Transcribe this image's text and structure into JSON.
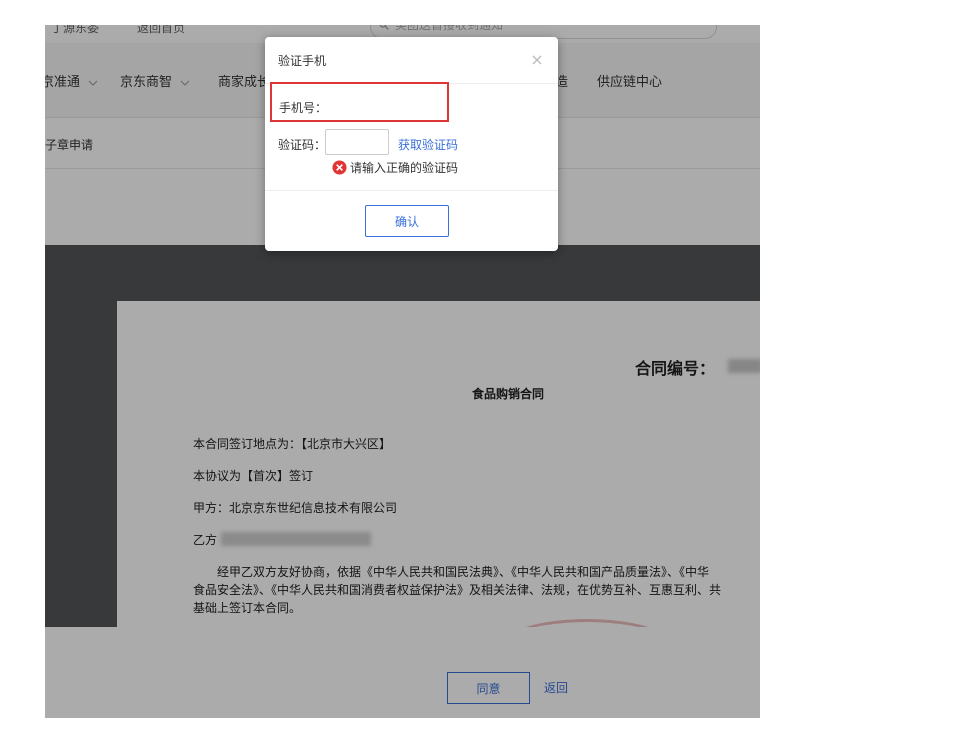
{
  "topbar": {
    "items": [
      "丁源东委",
      "返回首页"
    ],
    "search_placeholder": "美团送首接收到通知"
  },
  "nav": {
    "items": [
      "京准通",
      "京东商智",
      "商家成长",
      "造",
      "供应链中心"
    ]
  },
  "subnav": {
    "item": "子章申请"
  },
  "document": {
    "contract_no_label": "合同编号：",
    "title": "食品购销合同",
    "lines": [
      "本合同签订地点为：【北京市大兴区】",
      "本协议为【首次】签订",
      "甲方：北京京东世纪信息技术有限公司",
      "乙方",
      "　　经甲乙双方友好协商，依据《中华人民共和国民法典》、《中华人民共和国产品质量法》、《中华",
      "食品安全法》、《中华人民共和国消费者权益保护法》及相关法律、法规，在优势互补、互惠互利、共",
      "基础上签订本合同。"
    ]
  },
  "footer": {
    "agree_label": "同意",
    "back_label": "返回"
  },
  "modal": {
    "title": "验证手机",
    "close_symbol": "×",
    "phone_label": "手机号：",
    "code_label": "验证码：",
    "code_value": "",
    "get_code_label": "获取验证码",
    "error_message": "请输入正确的验证码",
    "confirm_label": "确认"
  },
  "colors": {
    "accent": "#3a6fd9",
    "error": "#e03535",
    "highlight_border": "#e03535",
    "viewer_bg": "#525659"
  }
}
